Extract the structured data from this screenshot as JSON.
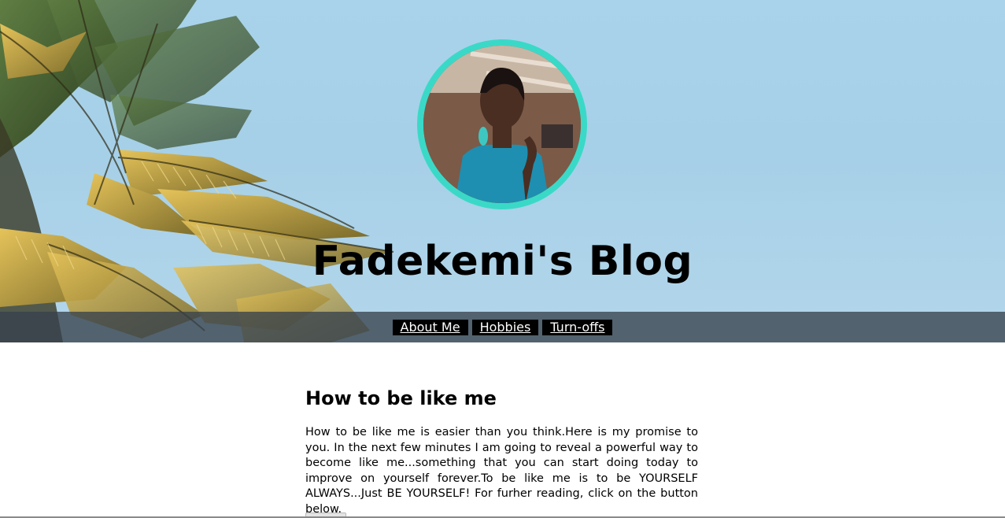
{
  "site": {
    "title": "Fadekemi's Blog"
  },
  "nav": {
    "items": [
      "About Me",
      "Hobbies",
      "Turn-offs"
    ]
  },
  "article": {
    "title": "How to be like me",
    "body": "How to be like me is easier than you think.Here is my promise to you. In the next few minutes I am going to reveal a powerful way to become like me...something that you can start doing today to improve on yourself forever.To be like me is to be YOURSELF ALWAYS...Just BE YOURSELF! For furher reading, click on the button below.",
    "button_label": ""
  },
  "colors": {
    "sky": "#a9d3ea",
    "avatar_ring": "#3ad9c7",
    "nav_bar": "#37414b",
    "nav_item_bg": "#000000",
    "nav_item_text": "#ffffff"
  },
  "icons": {
    "hero_background": "palm-tree-image",
    "profile": "profile-photo"
  }
}
